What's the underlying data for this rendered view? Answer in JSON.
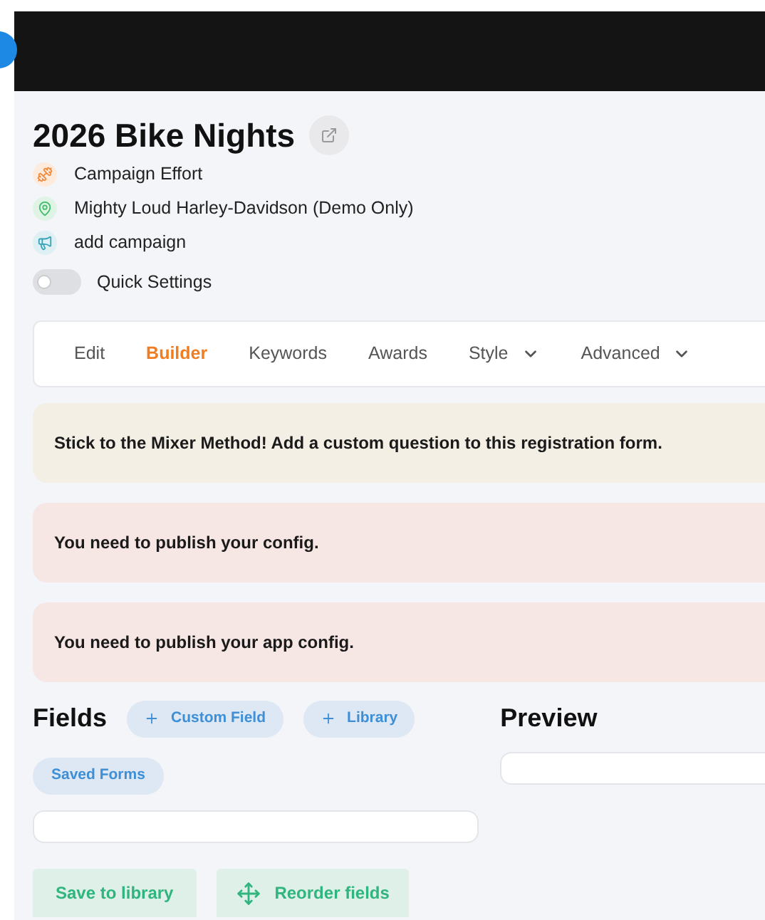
{
  "title": "2026 Bike Nights",
  "meta": [
    {
      "kind": "effort",
      "text": "Campaign Effort"
    },
    {
      "kind": "location",
      "text": "Mighty Loud Harley-Davidson (Demo Only)"
    },
    {
      "kind": "campaign",
      "text": "add campaign"
    }
  ],
  "quick_settings": {
    "label": "Quick Settings",
    "on": false
  },
  "tabs": [
    {
      "label": "Edit",
      "selected": false,
      "kind": "plain"
    },
    {
      "label": "Builder",
      "selected": true,
      "kind": "plain"
    },
    {
      "label": "Keywords",
      "selected": false,
      "kind": "plain"
    },
    {
      "label": "Awards",
      "selected": false,
      "kind": "plain"
    },
    {
      "label": "Style",
      "selected": false,
      "kind": "dropdown"
    },
    {
      "label": "Advanced",
      "selected": false,
      "kind": "dropdown"
    }
  ],
  "notices": [
    {
      "kind": "tip",
      "text": "Stick to the Mixer Method! Add a custom question to this registration form."
    },
    {
      "kind": "warning",
      "text": "You need to publish your config."
    },
    {
      "kind": "warning",
      "text": "You need to publish your app config."
    }
  ],
  "fields": {
    "heading": "Fields",
    "add_buttons": [
      "Custom Field",
      "Library"
    ],
    "saved_forms": "Saved Forms",
    "save_button": "Save to library",
    "reorder_button": "Reorder fields"
  },
  "preview": {
    "heading": "Preview"
  }
}
